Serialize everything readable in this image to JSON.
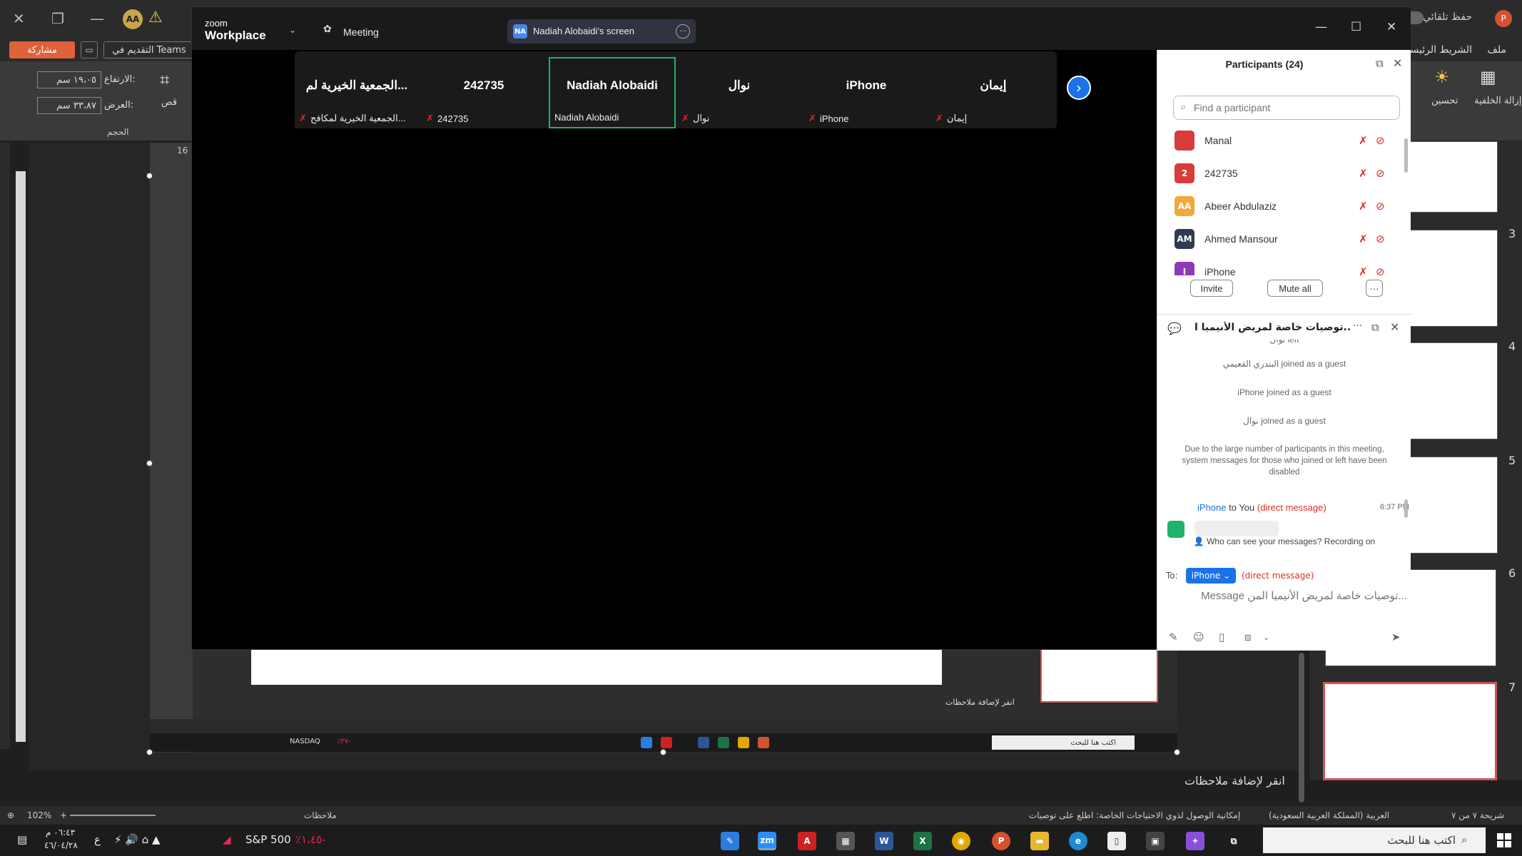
{
  "ppt": {
    "title_right": "حفظ تلقائي",
    "share_label": "مشاركة",
    "present_teams_label": "التقديم في Teams",
    "tab_file": "ملف",
    "tab_home": "الشريط الرئيسي",
    "height_label": "الارتفاع:",
    "height_value": "١٩،٠٥ سم",
    "width_label": "العرض:",
    "width_value": "٣٣،٨٧ سم",
    "crop_label": "قص",
    "size_group": "الحجم",
    "remove_bg_label": "إزالة الخلفية",
    "corrections_label": "تحسين",
    "ruler_mark": "16",
    "slide_numbers": [
      "3",
      "4",
      "5",
      "6",
      "7"
    ],
    "notes_placeholder": "انقر لإضافة ملاحظات",
    "status_slide": "شريحة ٧ من ٧",
    "status_lang": "العربية (المملكة العربية السعودية)",
    "status_access": "إمكانية الوصول لذوي الاحتياجات الخاصة: اطلع على توصيات",
    "status_notes": "ملاحظات",
    "zoom_level": "102%"
  },
  "taskbar": {
    "search_placeholder": "اكتب هنا للبحث",
    "stock_name": "S&P 500",
    "stock_change": "٪١،٤٥-",
    "time": "٠٦:٤٣ م",
    "date": "٤٦/٠٤/٢٨",
    "lang": "ع",
    "inner_stock": "NASDAQ",
    "inner_change": "٪٣٧-"
  },
  "zoom": {
    "logo_top": "zoom",
    "logo_bottom": "Workplace",
    "meeting_label": "Meeting",
    "presenter_initials": "NA",
    "screen_label": "Nadiah Alobaidi's screen",
    "tiles": [
      {
        "name": "الجمعية الخيرية لم...",
        "label": "الجمعية الخيرية لمكافح...",
        "muted": true
      },
      {
        "name": "242735",
        "label": "242735",
        "muted": true
      },
      {
        "name": "Nadiah Alobaidi",
        "label": "Nadiah Alobaidi",
        "muted": false
      },
      {
        "name": "نوال",
        "label": "نوال",
        "muted": true
      },
      {
        "name": "iPhone",
        "label": "iPhone",
        "muted": true
      },
      {
        "name": "إيمان",
        "label": "إيمان",
        "muted": true
      }
    ],
    "participants": {
      "title": "Participants (24)",
      "find_placeholder": "Find a participant",
      "list": [
        {
          "initials": "",
          "name": "Manal",
          "color": "#d93a3a"
        },
        {
          "initials": "2",
          "name": "242735",
          "color": "#d93a3a"
        },
        {
          "initials": "AA",
          "name": "Abeer Abdulaziz",
          "color": "#f2a83b"
        },
        {
          "initials": "AM",
          "name": "Ahmed Mansour",
          "color": "#2f3b52"
        },
        {
          "initials": "I",
          "name": "iPhone",
          "color": "#8e3ab8"
        }
      ],
      "invite": "Invite",
      "mute_all": "Mute all",
      "more": "···"
    },
    "chat": {
      "title": "توصيات خاصة لمريض الأنيميا ا...",
      "messages": [
        "نوال left",
        "البندري القعيمي joined as a guest",
        "iPhone joined as a guest",
        "نوال joined as a guest",
        "Due to the large number of participants in this meeting, system messages for those who joined or left have been disabled"
      ],
      "dm_from": "iPhone",
      "dm_to": "to You",
      "dm_tag": "(direct message)",
      "dm_time": "6:37 PM",
      "who_can_see": "Who can see your messages? Recording on",
      "to_label": "To:",
      "to_value": "iPhone",
      "to_tag": "(direct message)",
      "input_placeholder": "Message توصيات خاصة لمريض الأنيميا المن..."
    }
  }
}
